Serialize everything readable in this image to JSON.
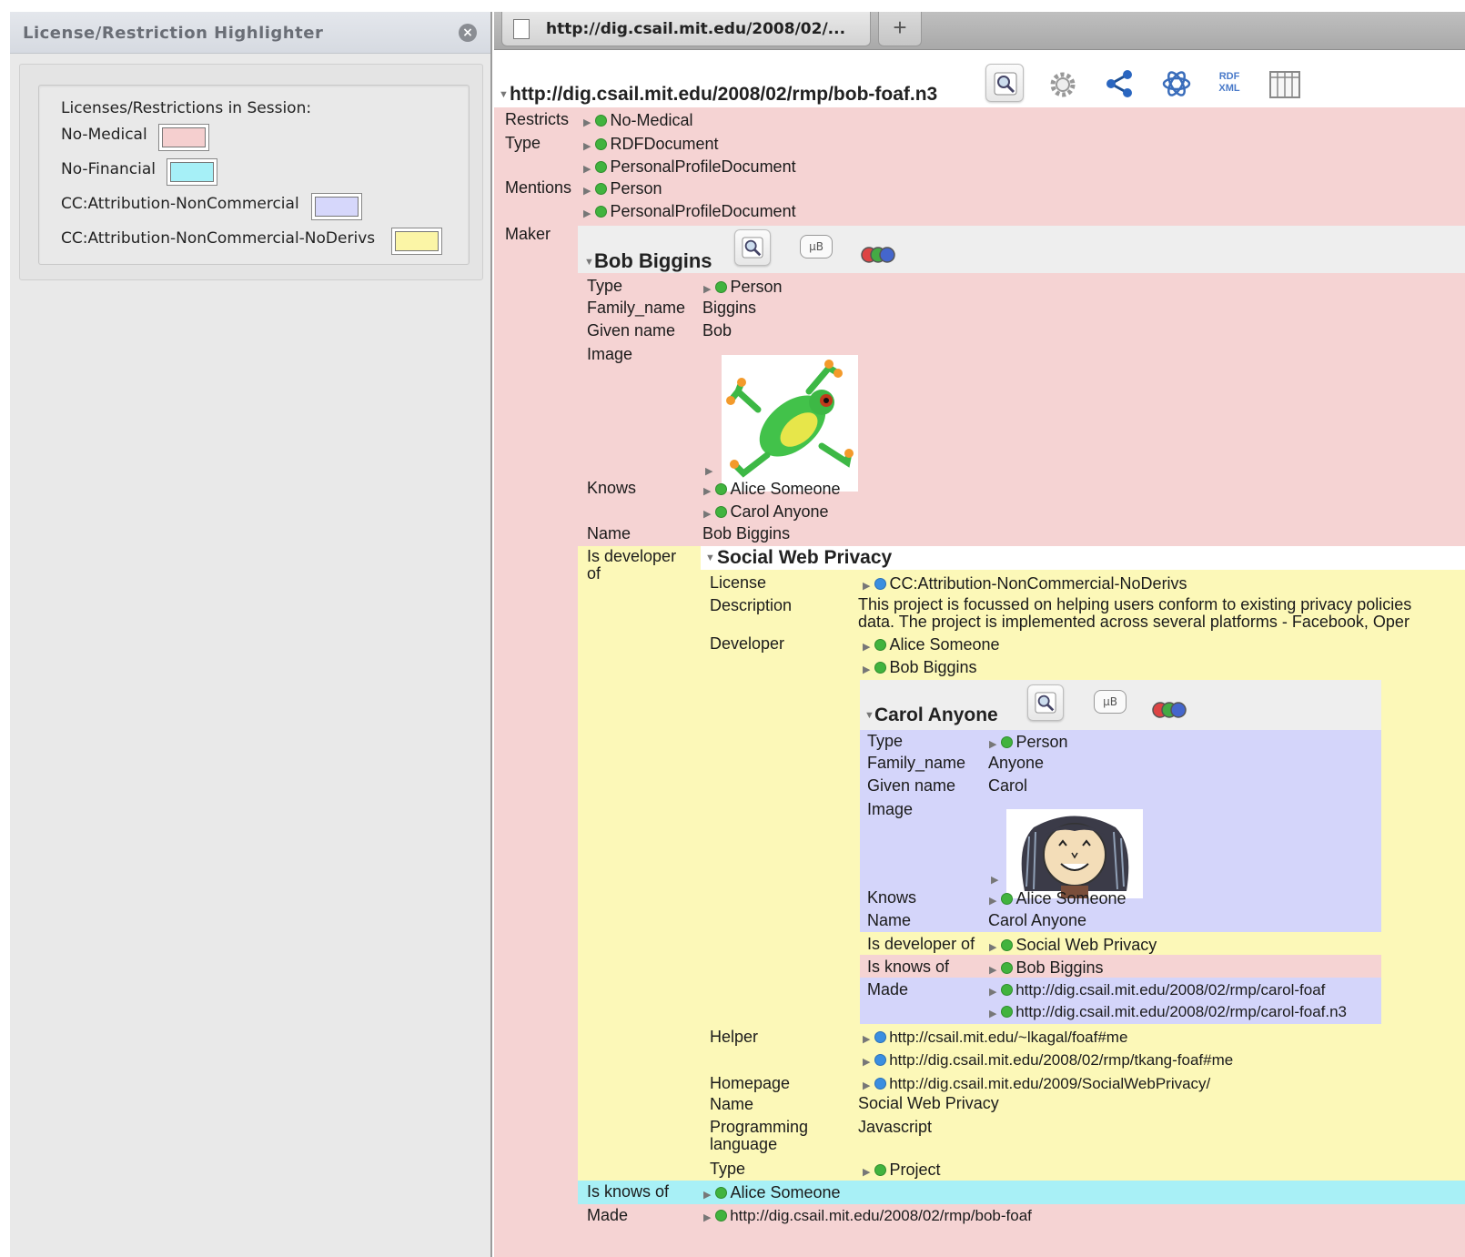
{
  "sidebar": {
    "title": "License/Restriction Highlighter",
    "close_icon": "close-icon",
    "heading": "Licenses/Restrictions in Session:",
    "licenses": [
      {
        "label": "No-Medical",
        "color": "#f5cfcf"
      },
      {
        "label": "No-Financial",
        "color": "#a6f0f7"
      },
      {
        "label": "CC:Attribution-NonCommercial",
        "color": "#d6d7fb"
      },
      {
        "label": "CC:Attribution-NonCommercial-NoDerivs",
        "color": "#fbf5a6"
      }
    ]
  },
  "tab": {
    "label": "http://dig.csail.mit.edu/2008/02/...",
    "new_tab": "+"
  },
  "doc": {
    "url": "http://dig.csail.mit.edu/2008/02/rmp/bob-foaf.n3",
    "toolbar_icons": [
      "magnifier-icon",
      "gear-icon",
      "share-graph-icon",
      "atom-icon",
      "rdf-xml-icon",
      "table-view-icon"
    ],
    "rdf_xml_text": "RDF XML",
    "restricts_label": "Restricts",
    "restricts": "No-Medical",
    "type_label": "Type",
    "types": [
      "RDFDocument",
      "PersonalProfileDocument"
    ],
    "mentions_label": "Mentions",
    "mentions": [
      "Person",
      "PersonalProfileDocument"
    ],
    "maker_label": "Maker"
  },
  "bob": {
    "title": "Bob Biggins",
    "mb_text": "µB",
    "labels": {
      "type": "Type",
      "family": "Family_name",
      "given": "Given name",
      "image": "Image",
      "knows": "Knows",
      "name": "Name",
      "dev": "Is developer of",
      "knowsof": "Is knows of",
      "made": "Made"
    },
    "type": "Person",
    "family": "Biggins",
    "given": "Bob",
    "knows": [
      "Alice Someone",
      "Carol Anyone"
    ],
    "name": "Bob Biggins",
    "knowsof": "Alice Someone",
    "made": "http://dig.csail.mit.edu/2008/02/rmp/bob-foaf"
  },
  "project": {
    "title": "Social Web Privacy",
    "labels": {
      "license": "License",
      "desc": "Description",
      "developer": "Developer",
      "helper": "Helper",
      "homepage": "Homepage",
      "name": "Name",
      "prog": "Programming language",
      "type": "Type"
    },
    "license": "CC:Attribution-NonCommercial-NoDerivs",
    "desc_line1": "This project is focussed on helping users conform to existing privacy policies",
    "desc_line2": "data. The project is implemented across several platforms - Facebook, Oper",
    "developers": [
      "Alice Someone",
      "Bob Biggins"
    ],
    "helpers": [
      "http://csail.mit.edu/~lkagal/foaf#me",
      "http://dig.csail.mit.edu/2008/02/rmp/tkang-foaf#me"
    ],
    "homepage": "http://dig.csail.mit.edu/2009/SocialWebPrivacy/",
    "name": "Social Web Privacy",
    "prog": "Javascript",
    "type": "Project"
  },
  "carol": {
    "title": "Carol Anyone",
    "type": "Person",
    "family": "Anyone",
    "given": "Carol",
    "knows": "Alice Someone",
    "name": "Carol Anyone",
    "dev": "Social Web Privacy",
    "knowsof": "Bob Biggins",
    "made": [
      "http://dig.csail.mit.edu/2008/02/rmp/carol-foaf",
      "http://dig.csail.mit.edu/2008/02/rmp/carol-foaf.n3"
    ]
  },
  "colors": {
    "pink": "#f5d3d3",
    "yellow": "#fcf8b8",
    "lavender": "#d4d5fa",
    "cyan": "#a8f0f6"
  }
}
